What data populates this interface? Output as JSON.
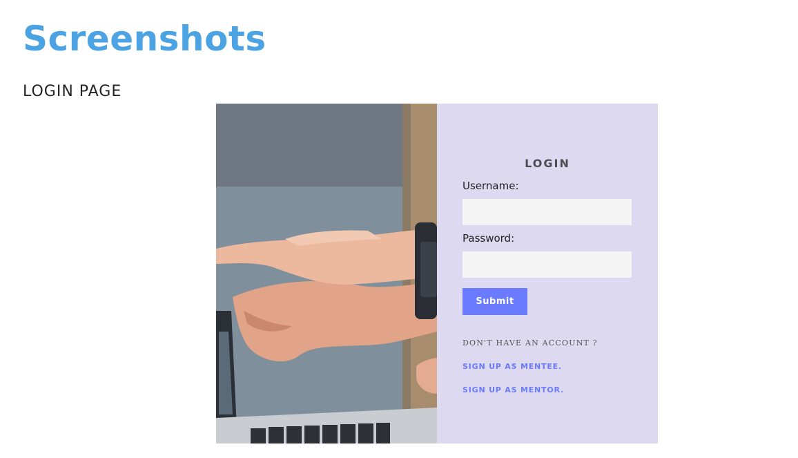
{
  "colors": {
    "title": "#4ba3e3",
    "panel_bg": "#dcd9f0",
    "button_bg": "#6a7bff",
    "link": "#6a7bff",
    "input_bg": "#f4f4f4"
  },
  "page": {
    "title": "Screenshots",
    "section_heading": "LOGIN PAGE"
  },
  "photo": {
    "icon": "laptop-hands-photo"
  },
  "login": {
    "title": "LOGIN",
    "username_label": "Username:",
    "username_value": "",
    "password_label": "Password:",
    "password_value": "",
    "submit_label": "Submit",
    "no_account_text": "DON'T HAVE AN ACCOUNT ?",
    "signup_mentee": "SIGN UP AS MENTEE.",
    "signup_mentor": "SIGN UP AS MENTOR."
  }
}
